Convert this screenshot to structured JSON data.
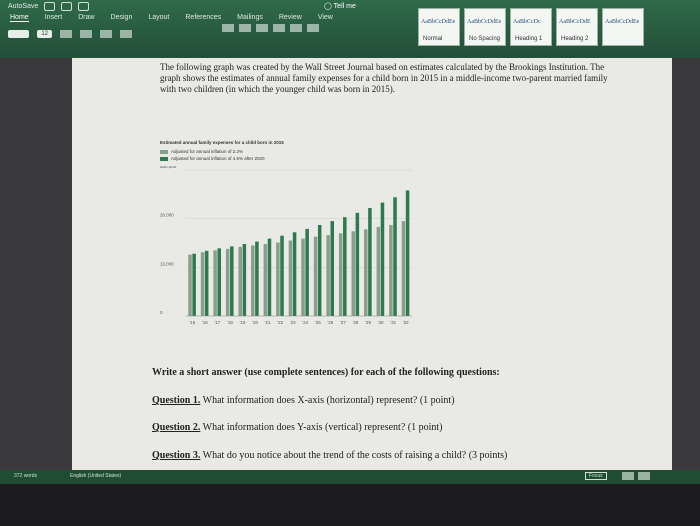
{
  "ribbon": {
    "qat_label": "AutoSave",
    "tabs": [
      "Home",
      "Insert",
      "Draw",
      "Design",
      "Layout",
      "References",
      "Mailings",
      "Review",
      "View"
    ],
    "active_tab": "Home",
    "tell_me": "Tell me",
    "font_size": "12",
    "style_samples": [
      "AaBbCcDdEe",
      "AaBbCcDdEe",
      "AaBbCcDc",
      "AaBbCcDdE",
      "AaBbCcDdEe"
    ],
    "style_names": [
      "Normal",
      "No Spacing",
      "Heading 1",
      "Heading 2",
      ""
    ]
  },
  "document": {
    "intro": "The following graph was created by the Wall Street Journal based on estimates calculated by the Brookings Institution. The graph shows the estimates of annual family expenses for a child born in 2015 in a middle-income two-parent married family with two children (in which the younger child was born in 2015).",
    "instruction": "Write a short answer (use complete sentences) for each of the following questions:",
    "questions": [
      {
        "label": "Question 1.",
        "text": "What information does X-axis (horizontal) represent? (1 point)"
      },
      {
        "label": "Question 2.",
        "text": "What information does Y-axis (vertical) represent? (1 point)"
      },
      {
        "label": "Question 3.",
        "text": "What do you notice about the trend of the costs of raising a child? (3 points)"
      }
    ]
  },
  "chart_data": {
    "type": "bar",
    "title": "Estimated annual family expenses for a child born in 2015",
    "series": [
      {
        "name": "Adjusted for annual inflation of 2.2%",
        "color": "#8a9e8c",
        "values": [
          12600,
          13100,
          13500,
          13800,
          14200,
          14500,
          14800,
          15100,
          15500,
          15900,
          16300,
          16600,
          17000,
          17400,
          17800,
          18300,
          18700,
          19500
        ]
      },
      {
        "name": "Adjusted for annual inflation of 4.5% after 2020",
        "color": "#2e7a4e",
        "values": [
          12800,
          13400,
          13900,
          14300,
          14800,
          15300,
          15900,
          16500,
          17200,
          17900,
          18700,
          19500,
          20300,
          21200,
          22200,
          23300,
          24400,
          25800
        ]
      }
    ],
    "categories": [
      "'15",
      "'16",
      "'17",
      "'18",
      "'19",
      "'20",
      "'21",
      "'22",
      "'23",
      "'24",
      "'25",
      "'26",
      "'27",
      "'28",
      "'29",
      "'30",
      "'31",
      "'32"
    ],
    "y_ticks": [
      "$30,000",
      "20,000",
      "10,000",
      "0"
    ],
    "ylim": [
      0,
      30000
    ]
  },
  "status": {
    "words": "372 words",
    "language": "English (United States)",
    "focus": "Focus"
  }
}
